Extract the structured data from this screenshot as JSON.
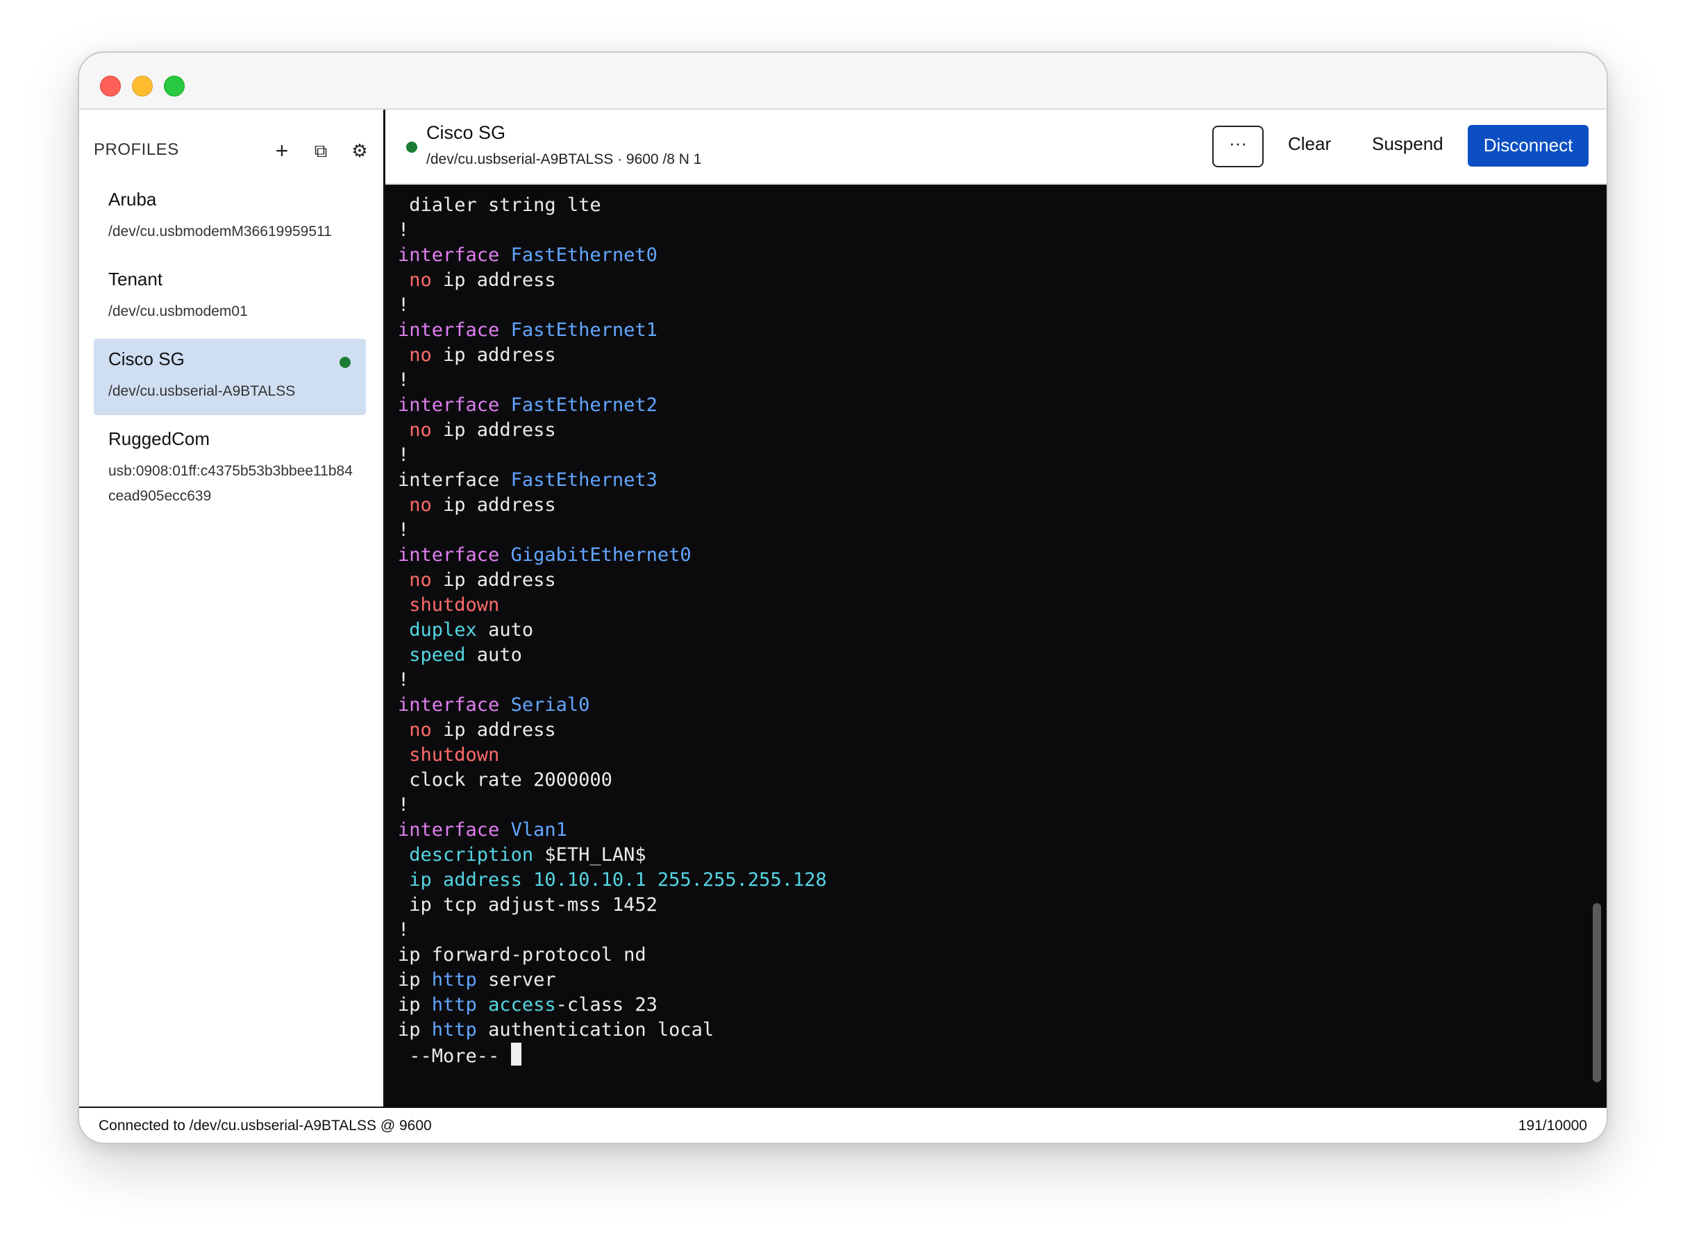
{
  "window": {
    "controls": [
      "close",
      "minimize",
      "zoom"
    ]
  },
  "sidebar": {
    "title": "PROFILES",
    "add_icon": "+",
    "duplicate_icon": "⧉",
    "settings_icon": "⚙",
    "profiles": [
      {
        "name": "Aruba",
        "path": "/dev/cu.usbmodemM36619959511",
        "active": false
      },
      {
        "name": "Tenant",
        "path": "/dev/cu.usbmodem01",
        "active": false
      },
      {
        "name": "Cisco SG",
        "path": "/dev/cu.usbserial-A9BTALSS",
        "active": true
      },
      {
        "name": "RuggedCom",
        "path": "usb:0908:01ff:c4375b53b3bbee11b84cead905ecc639",
        "active": false
      }
    ]
  },
  "header": {
    "title": "Cisco SG",
    "subtitle": "/dev/cu.usbserial-A9BTALSS · 9600 /8 N 1",
    "more_label": "···",
    "clear_label": "Clear",
    "suspend_label": "Suspend",
    "disconnect_label": "Disconnect",
    "status_color": "#1c7c33",
    "accent_color": "#0b4fc2"
  },
  "terminal": {
    "lines": [
      [
        {
          "t": " dialer string lte",
          "c": "white"
        }
      ],
      [
        {
          "t": "!",
          "c": "white"
        }
      ],
      [
        {
          "t": "interface ",
          "c": "pink"
        },
        {
          "t": "FastEthernet0",
          "c": "blue"
        }
      ],
      [
        {
          "t": " ",
          "c": "white"
        },
        {
          "t": "no",
          "c": "red"
        },
        {
          "t": " ip address",
          "c": "white"
        }
      ],
      [
        {
          "t": "!",
          "c": "white"
        }
      ],
      [
        {
          "t": "interface ",
          "c": "pink"
        },
        {
          "t": "FastEthernet1",
          "c": "blue"
        }
      ],
      [
        {
          "t": " ",
          "c": "white"
        },
        {
          "t": "no",
          "c": "red"
        },
        {
          "t": " ip address",
          "c": "white"
        }
      ],
      [
        {
          "t": "!",
          "c": "white"
        }
      ],
      [
        {
          "t": "interface ",
          "c": "pink"
        },
        {
          "t": "FastEthernet2",
          "c": "blue"
        }
      ],
      [
        {
          "t": " ",
          "c": "white"
        },
        {
          "t": "no",
          "c": "red"
        },
        {
          "t": " ip address",
          "c": "white"
        }
      ],
      [
        {
          "t": "!",
          "c": "white"
        }
      ],
      [
        {
          "t": "interface ",
          "c": "white"
        },
        {
          "t": "FastEthernet3",
          "c": "blue"
        }
      ],
      [
        {
          "t": " ",
          "c": "white"
        },
        {
          "t": "no",
          "c": "red"
        },
        {
          "t": " ip address",
          "c": "white"
        }
      ],
      [
        {
          "t": "!",
          "c": "white"
        }
      ],
      [
        {
          "t": "interface ",
          "c": "pink"
        },
        {
          "t": "GigabitEthernet0",
          "c": "blue"
        }
      ],
      [
        {
          "t": " ",
          "c": "white"
        },
        {
          "t": "no",
          "c": "red"
        },
        {
          "t": " ip address",
          "c": "white"
        }
      ],
      [
        {
          "t": " ",
          "c": "white"
        },
        {
          "t": "shutdown",
          "c": "red"
        }
      ],
      [
        {
          "t": " ",
          "c": "white"
        },
        {
          "t": "duplex",
          "c": "cyan"
        },
        {
          "t": " auto",
          "c": "white"
        }
      ],
      [
        {
          "t": " ",
          "c": "white"
        },
        {
          "t": "speed",
          "c": "cyan"
        },
        {
          "t": " auto",
          "c": "white"
        }
      ],
      [
        {
          "t": "!",
          "c": "white"
        }
      ],
      [
        {
          "t": "interface ",
          "c": "pink"
        },
        {
          "t": "Serial0",
          "c": "blue"
        }
      ],
      [
        {
          "t": " ",
          "c": "white"
        },
        {
          "t": "no",
          "c": "red"
        },
        {
          "t": " ip address",
          "c": "white"
        }
      ],
      [
        {
          "t": " ",
          "c": "white"
        },
        {
          "t": "shutdown",
          "c": "red"
        }
      ],
      [
        {
          "t": " clock rate 2000000",
          "c": "white"
        }
      ],
      [
        {
          "t": "!",
          "c": "white"
        }
      ],
      [
        {
          "t": "interface ",
          "c": "pink"
        },
        {
          "t": "Vlan1",
          "c": "blue"
        }
      ],
      [
        {
          "t": " ",
          "c": "white"
        },
        {
          "t": "description",
          "c": "cyan"
        },
        {
          "t": " $ETH_LAN$",
          "c": "white"
        }
      ],
      [
        {
          "t": " ",
          "c": "white"
        },
        {
          "t": "ip address 10.10.10.1 255.255.255.128",
          "c": "cyan"
        }
      ],
      [
        {
          "t": " ip tcp adjust-mss 1452",
          "c": "white"
        }
      ],
      [
        {
          "t": "!",
          "c": "white"
        }
      ],
      [
        {
          "t": "ip forward-protocol nd",
          "c": "white"
        }
      ],
      [
        {
          "t": "ip ",
          "c": "white"
        },
        {
          "t": "http",
          "c": "blue"
        },
        {
          "t": " server",
          "c": "white"
        }
      ],
      [
        {
          "t": "ip ",
          "c": "white"
        },
        {
          "t": "http",
          "c": "blue"
        },
        {
          "t": " ",
          "c": "white"
        },
        {
          "t": "access",
          "c": "cyan"
        },
        {
          "t": "-class 23",
          "c": "white"
        }
      ],
      [
        {
          "t": "ip ",
          "c": "white"
        },
        {
          "t": "http",
          "c": "blue"
        },
        {
          "t": " authentication local",
          "c": "white"
        }
      ],
      [
        {
          "t": " --More-- ",
          "c": "white"
        }
      ]
    ],
    "cursor_on_last_line": true
  },
  "status": {
    "left": "Connected to /dev/cu.usbserial-A9BTALSS @ 9600",
    "right": "191/10000"
  }
}
